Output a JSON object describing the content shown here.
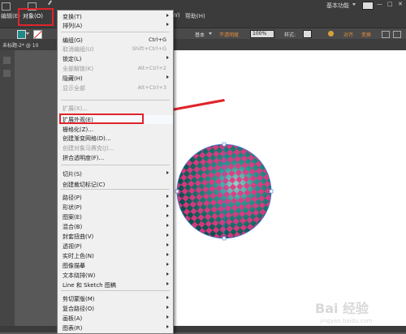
{
  "menubar": {
    "menu_left": "编辑(E)",
    "menu_object": "对象(O)",
    "menu_window": "W)",
    "menu_help": "帮助(H)",
    "workspace": "基本功能",
    "window_min": "—",
    "window_max": "□",
    "window_close": "✕"
  },
  "control_bar": {
    "stroke_style": "基本",
    "opacity_label": "不透明度",
    "opacity_value": "100%",
    "style_label": "样式:",
    "align_label": "对齐",
    "transform_label": "变换"
  },
  "document_tab": {
    "title": "未标题-2* @ 10"
  },
  "object_menu": {
    "items": [
      {
        "label": "变换(T)",
        "shortcut": "",
        "submenu": true,
        "disabled": false
      },
      {
        "label": "排列(A)",
        "shortcut": "",
        "submenu": true,
        "disabled": false
      },
      {
        "label": "编组(G)",
        "shortcut": "Ctrl+G",
        "submenu": false,
        "disabled": false
      },
      {
        "label": "取消编组(U)",
        "shortcut": "Shift+Ctrl+G",
        "submenu": false,
        "disabled": true
      },
      {
        "label": "锁定(L)",
        "shortcut": "",
        "submenu": true,
        "disabled": false
      },
      {
        "label": "全部解锁(K)",
        "shortcut": "Alt+Ctrl+2",
        "submenu": false,
        "disabled": true
      },
      {
        "label": "隐藏(H)",
        "shortcut": "",
        "submenu": true,
        "disabled": false
      },
      {
        "label": "显示全部",
        "shortcut": "Alt+Ctrl+3",
        "submenu": false,
        "disabled": true
      },
      {
        "label": "扩展(X)...",
        "shortcut": "",
        "submenu": false,
        "disabled": true
      },
      {
        "label": "扩展外观(E)",
        "shortcut": "",
        "submenu": false,
        "disabled": false
      },
      {
        "label": "栅格化(Z)...",
        "shortcut": "",
        "submenu": false,
        "disabled": false
      },
      {
        "label": "创建渐变网格(D)...",
        "shortcut": "",
        "submenu": false,
        "disabled": false
      },
      {
        "label": "创建对象马赛克(J)...",
        "shortcut": "",
        "submenu": false,
        "disabled": true
      },
      {
        "label": "拼合透明度(F)...",
        "shortcut": "",
        "submenu": false,
        "disabled": false
      },
      {
        "label": "切片(S)",
        "shortcut": "",
        "submenu": true,
        "disabled": false
      },
      {
        "label": "创建裁切标记(C)",
        "shortcut": "",
        "submenu": false,
        "disabled": false
      },
      {
        "label": "路径(P)",
        "shortcut": "",
        "submenu": true,
        "disabled": false
      },
      {
        "label": "形状(P)",
        "shortcut": "",
        "submenu": true,
        "disabled": false
      },
      {
        "label": "图案(E)",
        "shortcut": "",
        "submenu": true,
        "disabled": false
      },
      {
        "label": "混合(B)",
        "shortcut": "",
        "submenu": true,
        "disabled": false
      },
      {
        "label": "封套扭曲(V)",
        "shortcut": "",
        "submenu": true,
        "disabled": false
      },
      {
        "label": "透视(P)",
        "shortcut": "",
        "submenu": true,
        "disabled": false
      },
      {
        "label": "实时上色(N)",
        "shortcut": "",
        "submenu": true,
        "disabled": false
      },
      {
        "label": "图像描摹",
        "shortcut": "",
        "submenu": true,
        "disabled": false
      },
      {
        "label": "文本绕排(W)",
        "shortcut": "",
        "submenu": true,
        "disabled": false
      },
      {
        "label": "Line 和 Sketch 图稿",
        "shortcut": "",
        "submenu": true,
        "disabled": false
      },
      {
        "label": "剪切蒙版(M)",
        "shortcut": "",
        "submenu": true,
        "disabled": false
      },
      {
        "label": "复合路径(O)",
        "shortcut": "",
        "submenu": true,
        "disabled": false
      },
      {
        "label": "画板(A)",
        "shortcut": "",
        "submenu": true,
        "disabled": false
      },
      {
        "label": "图表(R)",
        "shortcut": "",
        "submenu": true,
        "disabled": false
      }
    ]
  },
  "colors": {
    "sphere_teal": "#1f8a87",
    "sphere_pink": "#e8357f",
    "highlight_box": "#e0242b",
    "selection_blue": "#3d7fd9"
  },
  "watermark": {
    "text": "Bai 经验",
    "url": "jingyan.baidu.com"
  }
}
